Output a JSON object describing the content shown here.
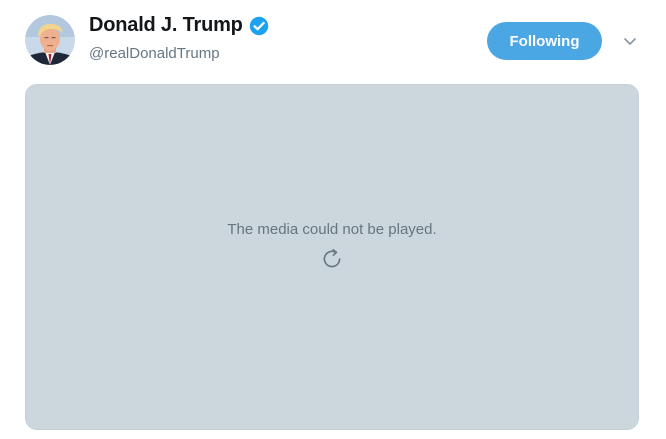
{
  "user": {
    "display_name": "Donald J. Trump",
    "handle": "@realDonaldTrump",
    "verified": true
  },
  "actions": {
    "follow_label": "Following"
  },
  "media": {
    "message": "The media could not be played."
  },
  "icons": {
    "verified": "verified-badge-icon",
    "caret": "chevron-down-icon",
    "retry": "retry-icon"
  },
  "colors": {
    "accent": "#4ba6e4",
    "verified": "#1da1f2",
    "media_background": "#ccd6dd",
    "secondary_text": "#657786"
  }
}
